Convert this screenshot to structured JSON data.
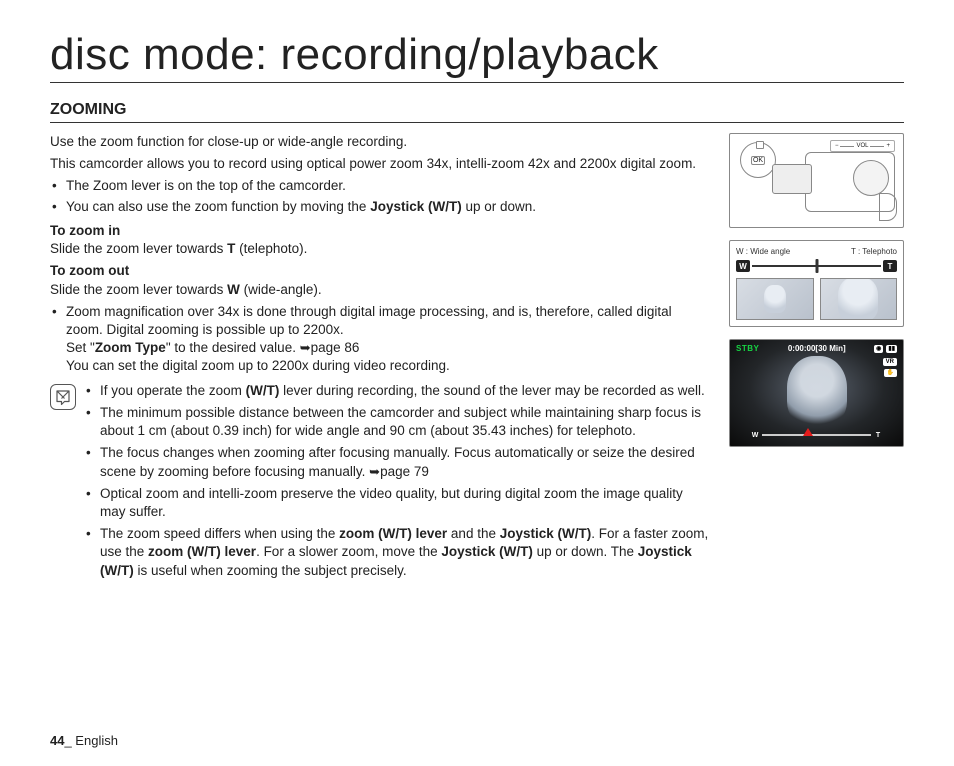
{
  "page_title": "disc mode: recording/playback",
  "section_title": "ZOOMING",
  "intro1": "Use the zoom function for close-up or wide-angle recording.",
  "intro2": "This camcorder allows you to record using optical power zoom 34x, intelli-zoom 42x and 2200x digital zoom.",
  "bullets_top": [
    {
      "pre": "The Zoom lever is on the top of the camcorder."
    },
    {
      "pre": "You can also use the zoom function by moving the ",
      "bold": "Joystick (W/T)",
      "post": " up or down."
    }
  ],
  "zoom_in_head": "To zoom in",
  "zoom_in_line_pre": "Slide the zoom lever towards ",
  "zoom_in_bold": "T",
  "zoom_in_line_post": " (telephoto).",
  "zoom_out_head": "To zoom out",
  "zoom_out_line_pre": "Slide the zoom lever towards ",
  "zoom_out_bold": "W",
  "zoom_out_line_post": " (wide-angle).",
  "zoom_out_bullet": {
    "l1": "Zoom magnification over 34x is done through digital image processing, and is, therefore, called digital zoom. Digital zooming is possible up to 2200x.",
    "l2_pre": "Set \"",
    "l2_bold": "Zoom Type",
    "l2_post": "\" to the desired value. ",
    "l2_page": "page 86",
    "l3": "You can set the digital zoom up to 2200x during video recording."
  },
  "notes": [
    {
      "t": "If you operate the zoom ",
      "b1": "(W/T)",
      "t2": " lever during recording, the sound of the lever may be recorded as well."
    },
    {
      "t": "The minimum possible distance between the camcorder and subject while maintaining sharp focus is about 1 cm (about 0.39 inch) for wide angle and 90 cm (about 35.43 inches) for telephoto."
    },
    {
      "t": "The focus changes when zooming after focusing manually. Focus automatically or seize the desired scene by zooming before focusing manually. ",
      "page": "page 79"
    },
    {
      "t": "Optical zoom and intelli-zoom preserve the video quality, but during digital zoom the image quality may suffer."
    },
    {
      "t": "The zoom speed differs when using the ",
      "b1": "zoom (W/T) lever",
      "t2": " and the ",
      "b2": "Joystick (W/T)",
      "t3": ". For a faster zoom, use the ",
      "b3": "zoom (W/T) lever",
      "t4": ". For a slower zoom, move the ",
      "b4": "Joystick (W/T)",
      "t5": " up or down. The ",
      "b5": "Joystick (W/T)",
      "t6": " is useful when zooming the subject precisely."
    }
  ],
  "fig2": {
    "left": "W : Wide angle",
    "right": "T : Telephoto",
    "cap_w": "W",
    "cap_t": "T"
  },
  "fig3": {
    "stby": "STBY",
    "timecode": "0:00:00[30 Min]",
    "w": "W",
    "t": "T"
  },
  "joy_ok": "OK",
  "vol_label": "VOL",
  "page_number": "44",
  "page_lang": "_ English"
}
